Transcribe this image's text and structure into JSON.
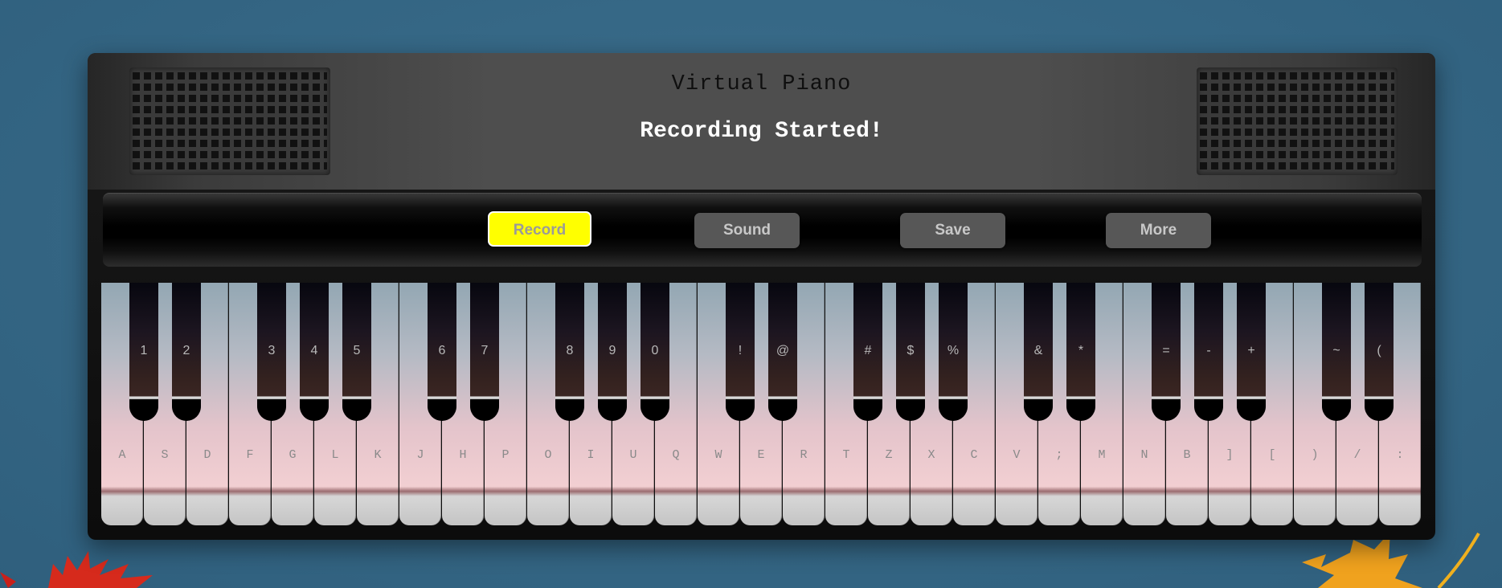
{
  "header": {
    "title": "Virtual Piano",
    "status": "Recording Started!"
  },
  "controls": [
    {
      "id": "record",
      "label": "Record",
      "active": true
    },
    {
      "id": "sound",
      "label": "Sound",
      "active": false
    },
    {
      "id": "save",
      "label": "Save",
      "active": false
    },
    {
      "id": "more",
      "label": "More",
      "active": false
    }
  ],
  "white_keys": [
    "A",
    "S",
    "D",
    "F",
    "G",
    "L",
    "K",
    "J",
    "H",
    "P",
    "O",
    "I",
    "U",
    "Q",
    "W",
    "E",
    "R",
    "T",
    "Z",
    "X",
    "C",
    "V",
    ";",
    "M",
    "N",
    "B",
    "]",
    "[",
    ")",
    "/",
    ":"
  ],
  "black_keys": [
    {
      "label": "1",
      "after_white": 0
    },
    {
      "label": "2",
      "after_white": 1
    },
    {
      "label": "3",
      "after_white": 3
    },
    {
      "label": "4",
      "after_white": 4
    },
    {
      "label": "5",
      "after_white": 5
    },
    {
      "label": "6",
      "after_white": 7
    },
    {
      "label": "7",
      "after_white": 8
    },
    {
      "label": "8",
      "after_white": 10
    },
    {
      "label": "9",
      "after_white": 11
    },
    {
      "label": "0",
      "after_white": 12
    },
    {
      "label": "!",
      "after_white": 14
    },
    {
      "label": "@",
      "after_white": 15
    },
    {
      "label": "#",
      "after_white": 17
    },
    {
      "label": "$",
      "after_white": 18
    },
    {
      "label": "%",
      "after_white": 19
    },
    {
      "label": "&",
      "after_white": 21
    },
    {
      "label": "*",
      "after_white": 22
    },
    {
      "label": "=",
      "after_white": 24
    },
    {
      "label": "-",
      "after_white": 25
    },
    {
      "label": "+",
      "after_white": 26
    },
    {
      "label": "~",
      "after_white": 28
    },
    {
      "label": "(",
      "after_white": 29
    }
  ],
  "colors": {
    "accent_active": "#ffff00",
    "button": "#575757",
    "background": "#366886"
  },
  "decorations": {
    "left_leaf": "maple-leaf-red-icon",
    "right_leaf": "maple-leaf-orange-icon"
  }
}
